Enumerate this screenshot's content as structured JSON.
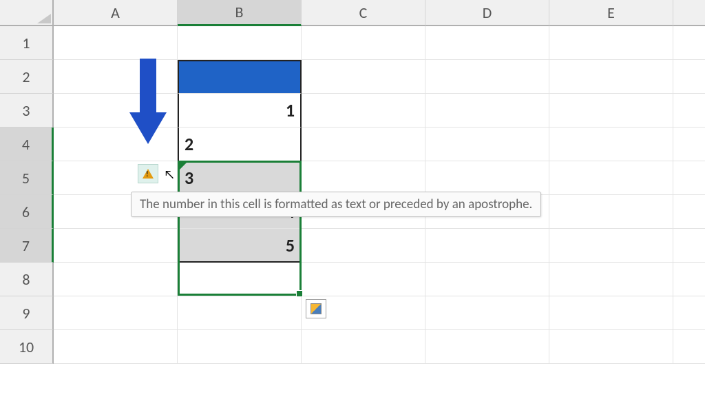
{
  "columns": [
    "A",
    "B",
    "C",
    "D",
    "E"
  ],
  "rows": [
    "1",
    "2",
    "3",
    "4",
    "5",
    "6",
    "7",
    "8",
    "9",
    "10"
  ],
  "selected_column": "B",
  "selected_rows": [
    "4",
    "5",
    "6",
    "7"
  ],
  "cells": {
    "B3": "1",
    "B4": "2",
    "B5": "3",
    "B6": "4",
    "B7": "5"
  },
  "tooltip_text": "The number in this cell is formatted as text or preceded by an apostrophe.",
  "smart_tag": {
    "icon": "warning-triangle",
    "hover_target": "B4"
  },
  "paste_options": {
    "near": "B8"
  },
  "annotation": {
    "type": "down-arrow",
    "color": "#1f4fc6",
    "points_to": "error-smart-tag"
  }
}
